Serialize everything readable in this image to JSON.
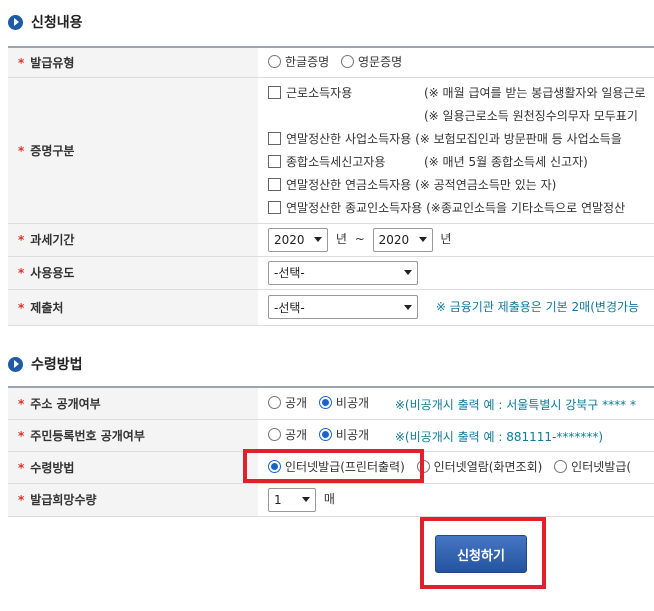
{
  "section1": {
    "title": "신청내용",
    "rows": {
      "issue_type": {
        "label": "발급유형",
        "options": [
          "한글증명",
          "영문증명"
        ]
      },
      "cert_category": {
        "label": "증명구분",
        "items": [
          {
            "label": "근로소득자용",
            "note": "(※ 매월 급여를 받는 봉급생활자와 일용근로"
          },
          {
            "label": "",
            "note": "(※ 일용근로소득 원천징수의무자 모두표기"
          },
          {
            "label": "연말정산한 사업소득자용",
            "note": "(※ 보험모집인과 방문판매 등 사업소득을"
          },
          {
            "label": "종합소득세신고자용",
            "note": "(※ 매년 5월 종합소득세 신고자)"
          },
          {
            "label": "연말정산한 연금소득자용",
            "note": "(※ 공적연금소득만 있는 자)"
          },
          {
            "label": "연말정산한 종교인소득자용",
            "note": "(※종교인소득을 기타소득으로 연말정산"
          }
        ]
      },
      "tax_period": {
        "label": "과세기간",
        "from": "2020",
        "from_unit": "년",
        "sep": "~",
        "to": "2020",
        "to_unit": "년"
      },
      "usage": {
        "label": "사용용도",
        "selected": "-선택-"
      },
      "submit_to": {
        "label": "제출처",
        "selected": "-선택-",
        "note": "※ 금융기관 제출용은 기본 2매(변경가능"
      }
    }
  },
  "section2": {
    "title": "수령방법",
    "rows": {
      "address_disclosure": {
        "label": "주소 공개여부",
        "options": [
          "공개",
          "비공개"
        ],
        "note": "※(비공개시 출력 예 : 서울특별시 강북구 **** *"
      },
      "rrn_disclosure": {
        "label": "주민등록번호 공개여부",
        "options": [
          "공개",
          "비공개"
        ],
        "note": "※(비공개시 출력 예 : 881111-*******)"
      },
      "receive_method": {
        "label": "수령방법",
        "options": [
          "인터넷발급(프린터출력)",
          "인터넷열람(화면조회)",
          "인터넷발급("
        ]
      },
      "quantity": {
        "label": "발급희망수량",
        "selected": "1",
        "unit": "매"
      }
    }
  },
  "submit": {
    "label": "신청하기"
  },
  "colors": {
    "accent": "#1f5aa6",
    "required": "#e0302b",
    "highlight": "#e0202a",
    "note": "#0f7a9a"
  }
}
